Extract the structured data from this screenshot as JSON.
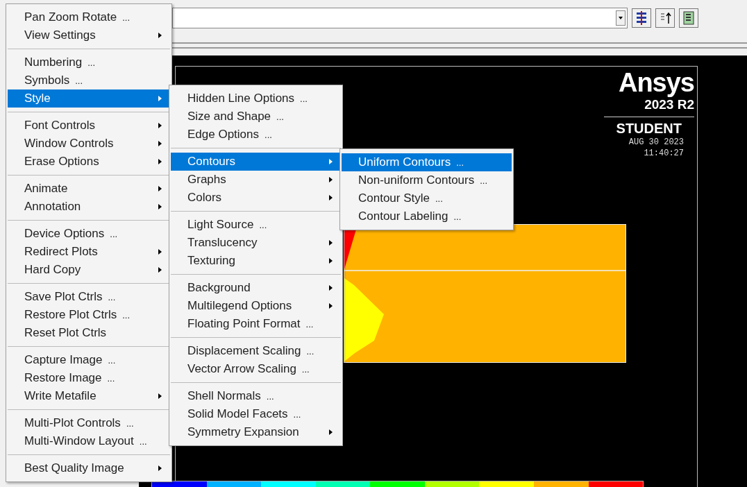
{
  "logo": {
    "brand": "Ansys",
    "version": "2023 R2",
    "edition": "STUDENT",
    "date": "AUG 30 2023",
    "time": "11:40:27"
  },
  "legend": [
    {
      "color": "#0000ff"
    },
    {
      "color": "#00b2ff"
    },
    {
      "color": "#00ffff"
    },
    {
      "color": "#00ffb2"
    },
    {
      "color": "#00ff00"
    },
    {
      "color": "#b2ff00"
    },
    {
      "color": "#ffff00"
    },
    {
      "color": "#ffb200"
    },
    {
      "color": "#ff0000"
    }
  ],
  "menus": [
    {
      "groups": [
        [
          {
            "label": "Pan Zoom Rotate",
            "ellipsis": "...",
            "submenu": false,
            "selected": false
          },
          {
            "label": "View Settings",
            "submenu": true,
            "selected": false
          }
        ],
        [
          {
            "label": "Numbering",
            "ellipsis": "...",
            "submenu": false,
            "selected": false
          },
          {
            "label": "Symbols",
            "ellipsis": "...",
            "submenu": false,
            "selected": false
          },
          {
            "label": "Style",
            "submenu": true,
            "selected": true
          }
        ],
        [
          {
            "label": "Font Controls",
            "submenu": true,
            "selected": false
          },
          {
            "label": "Window Controls",
            "submenu": true,
            "selected": false
          },
          {
            "label": "Erase Options",
            "submenu": true,
            "selected": false
          }
        ],
        [
          {
            "label": "Animate",
            "submenu": true,
            "selected": false
          },
          {
            "label": "Annotation",
            "submenu": true,
            "selected": false
          }
        ],
        [
          {
            "label": "Device Options",
            "ellipsis": "...",
            "submenu": false,
            "selected": false
          },
          {
            "label": "Redirect Plots",
            "submenu": true,
            "selected": false
          },
          {
            "label": "Hard Copy",
            "submenu": true,
            "selected": false
          }
        ],
        [
          {
            "label": "Save Plot Ctrls",
            "ellipsis": "...",
            "submenu": false,
            "selected": false
          },
          {
            "label": "Restore Plot Ctrls",
            "ellipsis": "...",
            "submenu": false,
            "selected": false
          },
          {
            "label": "Reset Plot Ctrls",
            "submenu": false,
            "selected": false
          }
        ],
        [
          {
            "label": "Capture Image",
            "ellipsis": "...",
            "submenu": false,
            "selected": false
          },
          {
            "label": "Restore Image",
            "ellipsis": "...",
            "submenu": false,
            "selected": false
          },
          {
            "label": "Write Metafile",
            "submenu": true,
            "selected": false
          }
        ],
        [
          {
            "label": "Multi-Plot Controls",
            "ellipsis": "...",
            "submenu": false,
            "selected": false
          },
          {
            "label": "Multi-Window Layout",
            "ellipsis": "...",
            "submenu": false,
            "selected": false
          }
        ],
        [
          {
            "label": "Best Quality Image",
            "submenu": true,
            "selected": false
          }
        ]
      ]
    },
    {
      "groups": [
        [
          {
            "label": "Hidden Line Options",
            "ellipsis": "...",
            "submenu": false,
            "selected": false
          },
          {
            "label": "Size and Shape",
            "ellipsis": "...",
            "submenu": false,
            "selected": false
          },
          {
            "label": "Edge Options",
            "ellipsis": "...",
            "submenu": false,
            "selected": false
          }
        ],
        [
          {
            "label": "Contours",
            "submenu": true,
            "selected": true
          },
          {
            "label": "Graphs",
            "submenu": true,
            "selected": false
          },
          {
            "label": "Colors",
            "submenu": true,
            "selected": false
          }
        ],
        [
          {
            "label": "Light Source",
            "ellipsis": "...",
            "submenu": false,
            "selected": false
          },
          {
            "label": "Translucency",
            "submenu": true,
            "selected": false
          },
          {
            "label": "Texturing",
            "submenu": true,
            "selected": false
          }
        ],
        [
          {
            "label": "Background",
            "submenu": true,
            "selected": false
          },
          {
            "label": "Multilegend Options",
            "submenu": true,
            "selected": false
          },
          {
            "label": "Floating Point Format",
            "ellipsis": "...",
            "submenu": false,
            "selected": false
          }
        ],
        [
          {
            "label": "Displacement Scaling",
            "ellipsis": "...",
            "submenu": false,
            "selected": false
          },
          {
            "label": "Vector Arrow Scaling",
            "ellipsis": "...",
            "submenu": false,
            "selected": false
          }
        ],
        [
          {
            "label": "Shell Normals",
            "ellipsis": "...",
            "submenu": false,
            "selected": false
          },
          {
            "label": "Solid Model Facets",
            "ellipsis": "...",
            "submenu": false,
            "selected": false
          },
          {
            "label": "Symmetry Expansion",
            "submenu": true,
            "selected": false
          }
        ]
      ]
    },
    {
      "groups": [
        [
          {
            "label": "Uniform Contours",
            "ellipsis": "...",
            "submenu": false,
            "selected": true
          },
          {
            "label": "Non-uniform Contours",
            "ellipsis": "...",
            "submenu": false,
            "selected": false
          },
          {
            "label": "Contour Style",
            "ellipsis": "...",
            "submenu": false,
            "selected": false
          },
          {
            "label": "Contour Labeling",
            "ellipsis": "...",
            "submenu": false,
            "selected": false
          }
        ]
      ]
    }
  ]
}
